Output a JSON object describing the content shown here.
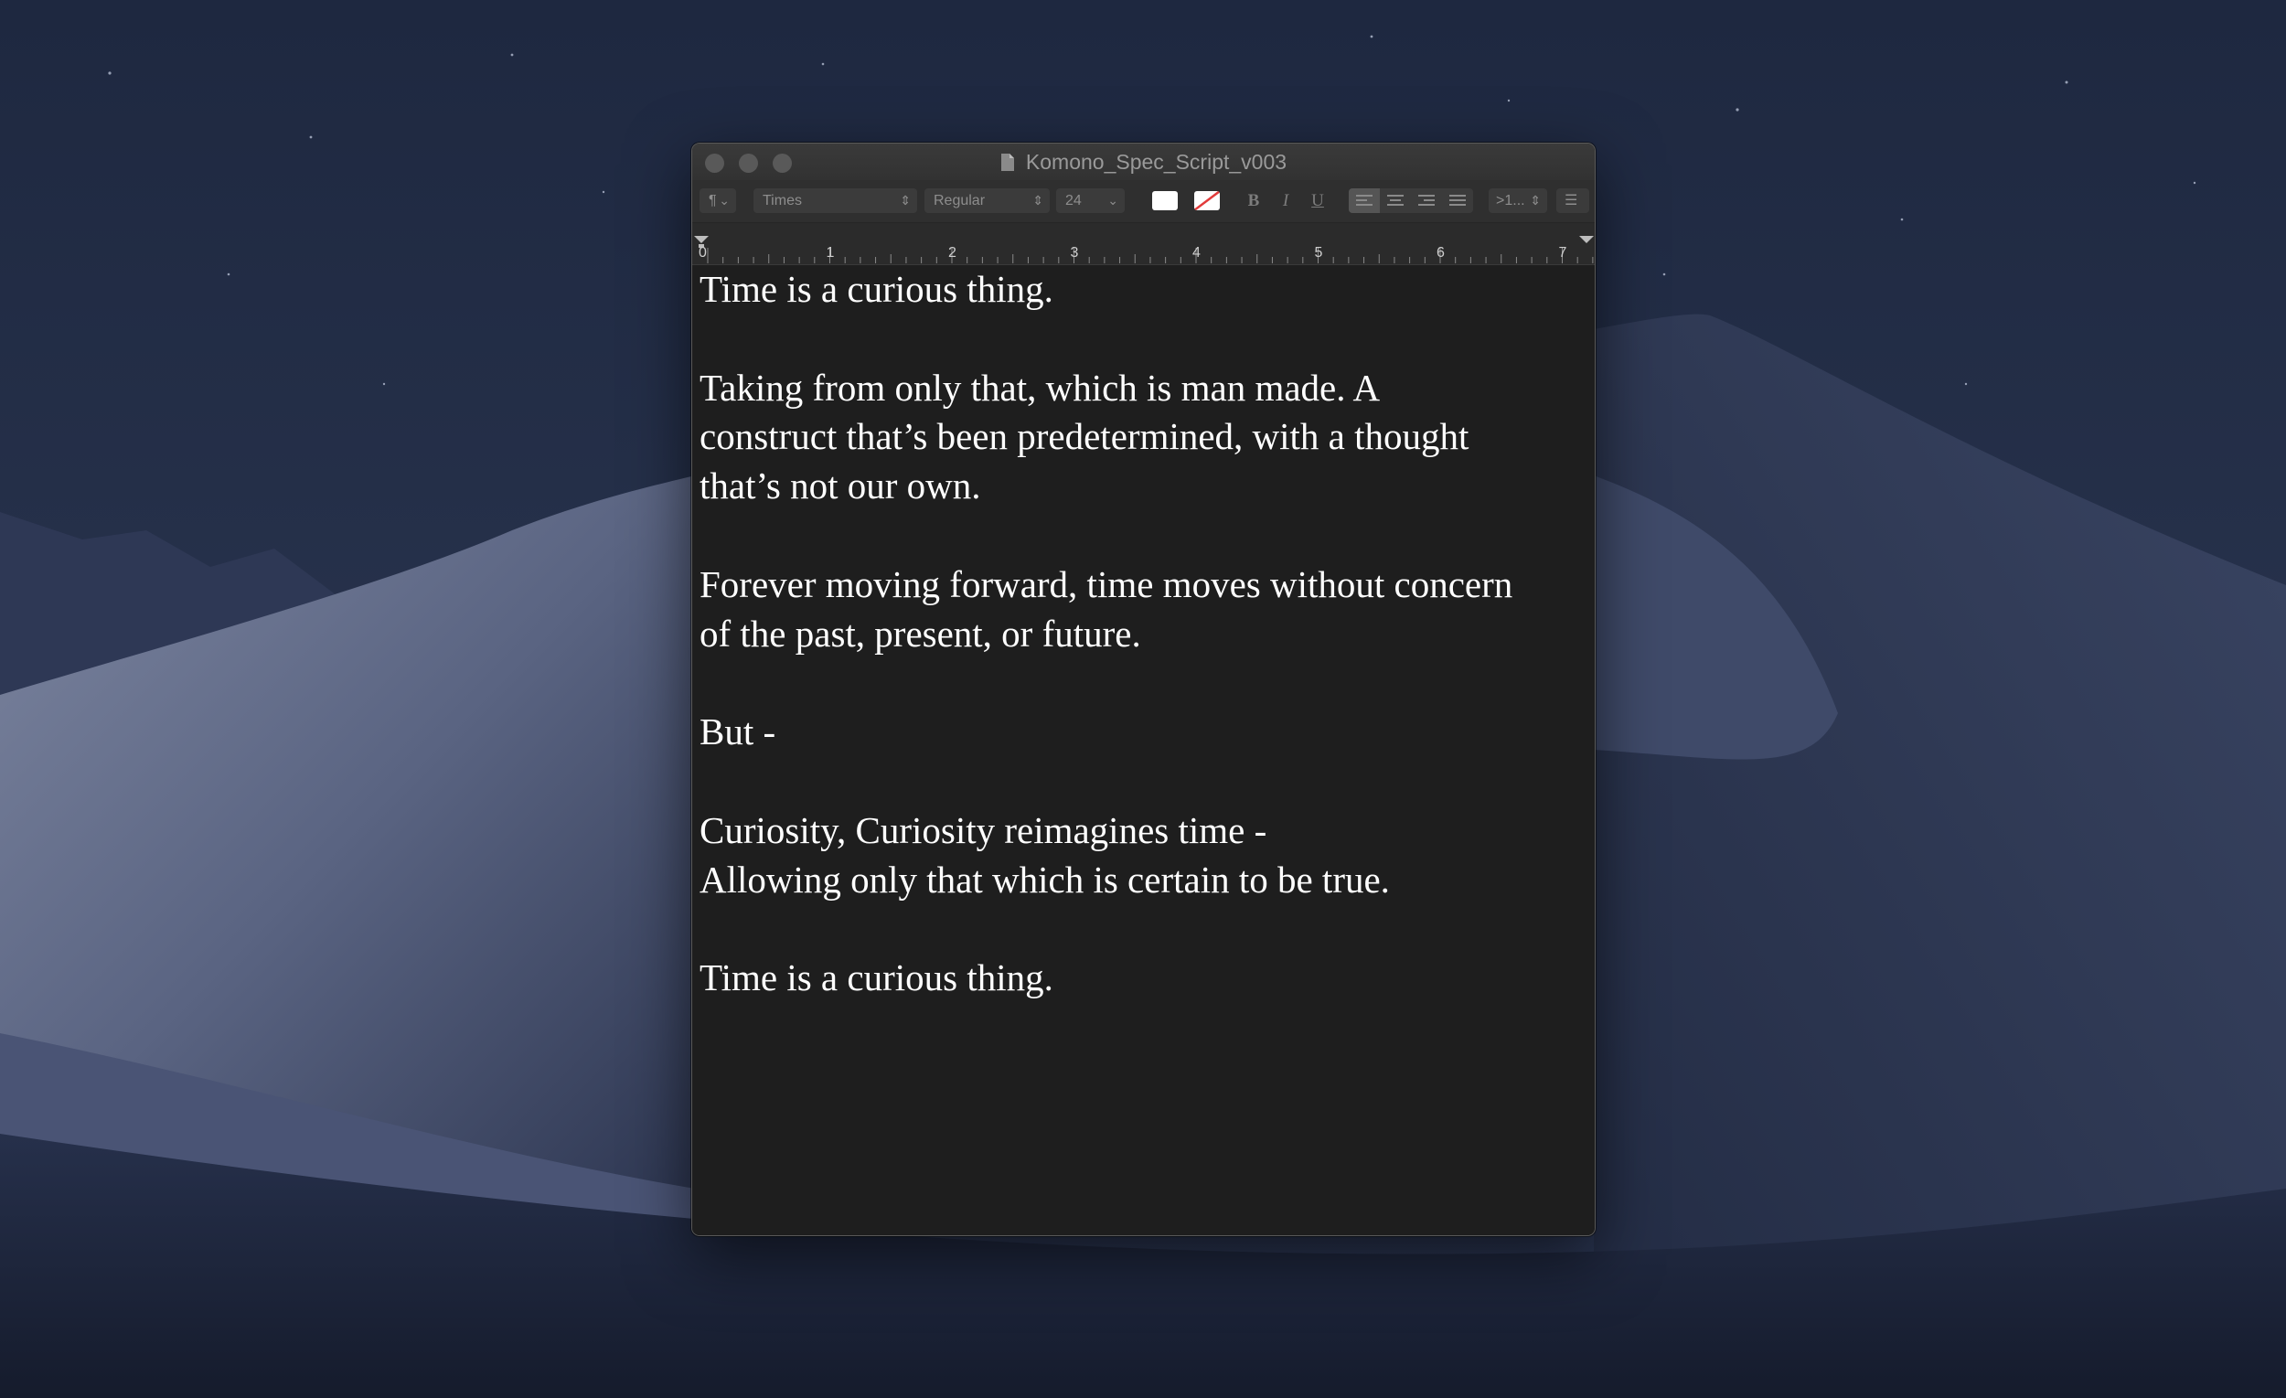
{
  "window": {
    "title": "Komono_Spec_Script_v003"
  },
  "toolbar": {
    "paragraph_style": "¶",
    "font_family": "Times",
    "font_style": "Regular",
    "font_size": "24",
    "bold_label": "B",
    "italic_label": "I",
    "underline_label": "U",
    "line_spacing": ">1...",
    "list_label": "☰",
    "text_color": "#ffffff"
  },
  "ruler": {
    "numbers": [
      "0",
      "1",
      "2",
      "3",
      "4",
      "5",
      "6",
      "7"
    ]
  },
  "document": {
    "lines": [
      "Time is a curious thing.",
      "",
      "Taking from only that, which is man made. A",
      "construct that’s been predetermined, with a thought",
      "that’s not our own.",
      "",
      "Forever moving forward, time moves without concern",
      "of the past, present, or future.",
      "",
      "But -",
      "",
      "Curiosity, Curiosity reimagines time -",
      "Allowing only that which is certain to be true.",
      "",
      "Time is a curious thing."
    ]
  }
}
